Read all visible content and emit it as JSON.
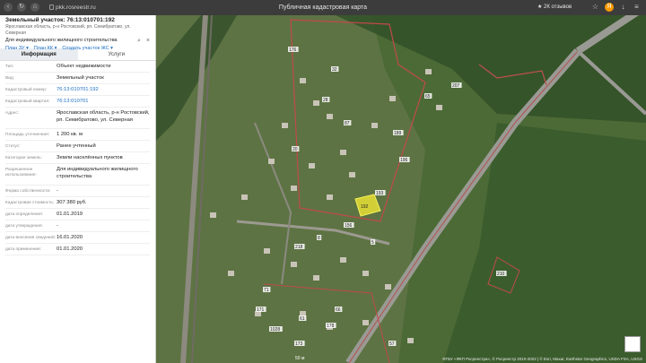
{
  "browser": {
    "url": "pkk.rosreestr.ru",
    "title": "Публичная кадастровая карта",
    "reviews": "★ 2К отзывов"
  },
  "panel": {
    "title": "Земельный участок: 76:13:010701:192",
    "address_short": "Ярославская область, р-н Ростовский, рп. Семибратово, ул. Северная",
    "usage_short": "Для индивидуального жилищного строительства",
    "links": [
      "План ЗУ ▾",
      "План КК ▾",
      "Создать участок ЖС ▾"
    ],
    "tabs": [
      "Информация",
      "Услуги"
    ],
    "rows": [
      {
        "key": "Тип:",
        "value": "Объект недвижимости",
        "link": false
      },
      {
        "key": "Вид:",
        "value": "Земельный участок",
        "link": false
      },
      {
        "key": "Кадастровый номер:",
        "value": "76:13:010701:192",
        "link": true
      },
      {
        "key": "Кадастровый квартал:",
        "value": "76:13:010701",
        "link": true
      },
      {
        "key": "Адрес:",
        "value": "Ярославская область, р-н Ростовский, рп. Семибратово, ул. Северная",
        "link": false
      },
      {
        "key": "Площадь уточненная:",
        "value": "1 200 кв. м",
        "link": false
      },
      {
        "key": "Статус:",
        "value": "Ранее учтенный",
        "link": false
      },
      {
        "key": "Категория земель:",
        "value": "Земли населённых пунктов",
        "link": false
      },
      {
        "key": "Разрешенное использование:",
        "value": "Для индивидуального жилищного строительства",
        "link": false
      },
      {
        "key": "Форма собственности:",
        "value": "-",
        "link": false
      },
      {
        "key": "Кадастровая стоимость:",
        "value": "307 380 руб.",
        "link": false
      },
      {
        "key": "дата определения:",
        "value": "01.01.2019",
        "link": false
      },
      {
        "key": "дата утверждения:",
        "value": "-",
        "link": false
      },
      {
        "key": "дата внесения сведений:",
        "value": "16.01.2020",
        "link": false
      },
      {
        "key": "дата применения:",
        "value": "01.01.2020",
        "link": false
      }
    ]
  },
  "map": {
    "selected_label": "192",
    "labels": [
      "176",
      "28",
      "32",
      "20",
      "87",
      "207",
      "65",
      "189",
      "196",
      "192",
      "193",
      "156",
      "8",
      "5",
      "218",
      "210",
      "171",
      "178",
      "61",
      "71",
      "173",
      "1028",
      "66",
      "57"
    ],
    "scale": "50 м",
    "attribution": "ФГБУ «ФКП Росреестра», © Росреестр 2010-2022 | © Esri, Maxar, Earthstar Geographics, USDA FSA, USGS"
  }
}
